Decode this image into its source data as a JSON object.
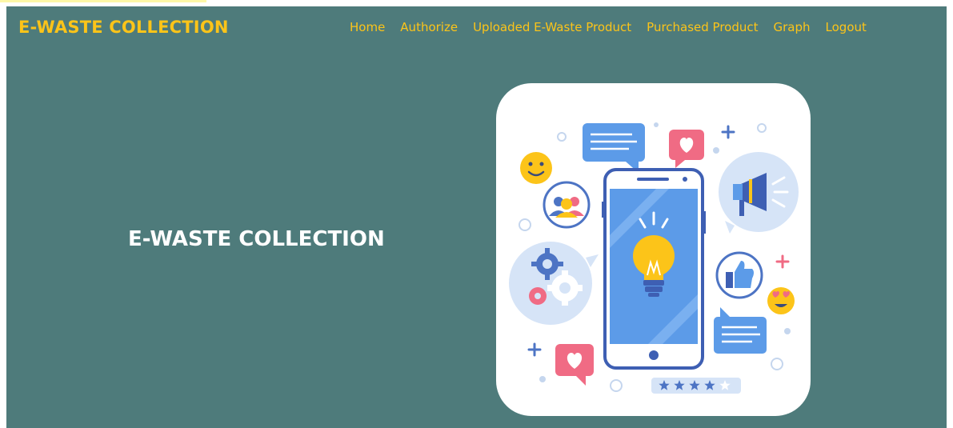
{
  "header": {
    "brand": "E-WASTE COLLECTION",
    "nav": [
      "Home",
      "Authorize",
      "Uploaded E-Waste Product",
      "Purchased Product",
      "Graph",
      "Logout"
    ]
  },
  "hero": {
    "title": "E-WASTE COLLECTION",
    "illustration_icons": [
      "phone-icon",
      "lightbulb-icon",
      "megaphone-icon",
      "thumbs-up-icon",
      "heart-icon",
      "smiley-icon",
      "gear-icon",
      "people-icon",
      "chat-bubble-icon",
      "star-rating-icon"
    ],
    "rating_stars": 4
  },
  "colors": {
    "page_bg": "#4e7b7b",
    "accent": "#fcc419",
    "hero_text": "#ffffff",
    "card_bg": "#ffffff"
  }
}
